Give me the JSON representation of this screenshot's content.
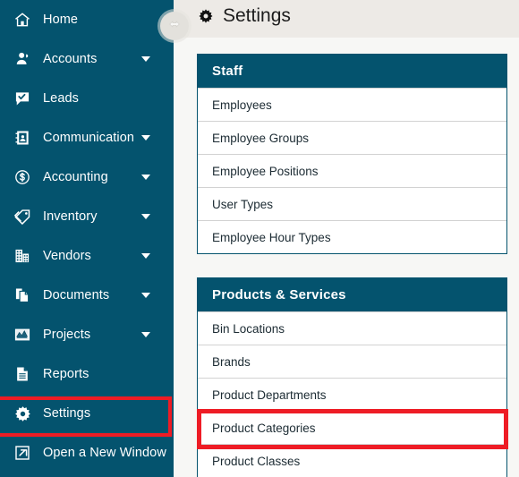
{
  "sidebar": {
    "items": [
      {
        "label": "Home",
        "icon": "home-icon",
        "caret": false
      },
      {
        "label": "Accounts",
        "icon": "user-icon",
        "caret": true
      },
      {
        "label": "Leads",
        "icon": "chat-check-icon",
        "caret": false
      },
      {
        "label": "Communication",
        "icon": "contact-book-icon",
        "caret": true
      },
      {
        "label": "Accounting",
        "icon": "dollar-circle-icon",
        "caret": true
      },
      {
        "label": "Inventory",
        "icon": "tag-icon",
        "caret": true
      },
      {
        "label": "Vendors",
        "icon": "building-icon",
        "caret": true
      },
      {
        "label": "Documents",
        "icon": "copy-icon",
        "caret": true
      },
      {
        "label": "Projects",
        "icon": "chart-icon",
        "caret": true
      },
      {
        "label": "Reports",
        "icon": "document-icon",
        "caret": false
      },
      {
        "label": "Settings",
        "icon": "gear-icon",
        "caret": false
      },
      {
        "label": "Open a New Window",
        "icon": "external-link-icon",
        "caret": false
      }
    ],
    "active_item": "Settings",
    "background_color": "#04536e"
  },
  "collapse_toggle": {
    "icon": "double-arrow-horizontal-icon",
    "background_color": "#e3e1dc"
  },
  "header": {
    "title": "Settings",
    "icon": "gear-icon",
    "background_color": "#edeae6"
  },
  "panels": [
    {
      "title": "Staff",
      "rows": [
        "Employees",
        "Employee Groups",
        "Employee Positions",
        "User Types",
        "Employee Hour Types"
      ]
    },
    {
      "title": "Products & Services",
      "rows": [
        "Bin Locations",
        "Brands",
        "Product Departments",
        "Product Categories",
        "Product Classes"
      ]
    }
  ],
  "highlights": {
    "color": "#ee1c25",
    "targets": [
      "Settings",
      "Product Categories"
    ]
  }
}
